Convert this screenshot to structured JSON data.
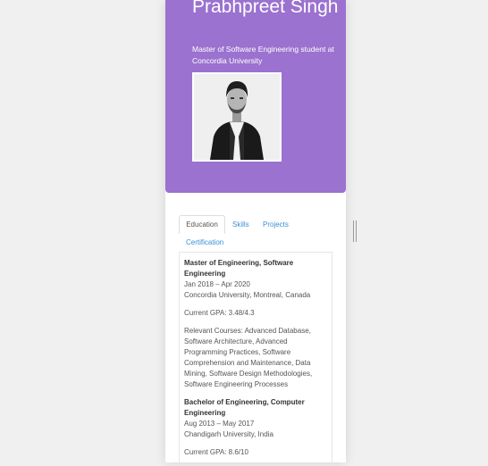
{
  "profile": {
    "name": "Prabhpreet Singh",
    "subtitle": "Master of Software Engineering student at Concordia University"
  },
  "tabs": [
    {
      "label": "Education",
      "active": true
    },
    {
      "label": "Skills",
      "active": false
    },
    {
      "label": "Projects",
      "active": false
    },
    {
      "label": "Certification",
      "active": false
    }
  ],
  "education": [
    {
      "degree": "Master of Engineering, Software Engineering",
      "dates": "Jan 2018 – Apr 2020",
      "institution": "Concordia University, Montreal, Canada",
      "gpa": "Current GPA: 3.48/4.3",
      "courses": "Relevant Courses: Advanced Database, Software Architecture, Advanced Programming Practices, Software Comprehension and Maintenance, Data Mining, Software Design Methodologies, Software Engineering Processes"
    },
    {
      "degree": "Bachelor of Engineering, Computer Engineering",
      "dates": "Aug 2013 – May 2017",
      "institution": "Chandigarh University, India",
      "gpa": "Current GPA: 8.6/10"
    }
  ],
  "colors": {
    "hero": "#9b72cf",
    "link": "#3b8fd8",
    "background": "#f0f0f0"
  }
}
